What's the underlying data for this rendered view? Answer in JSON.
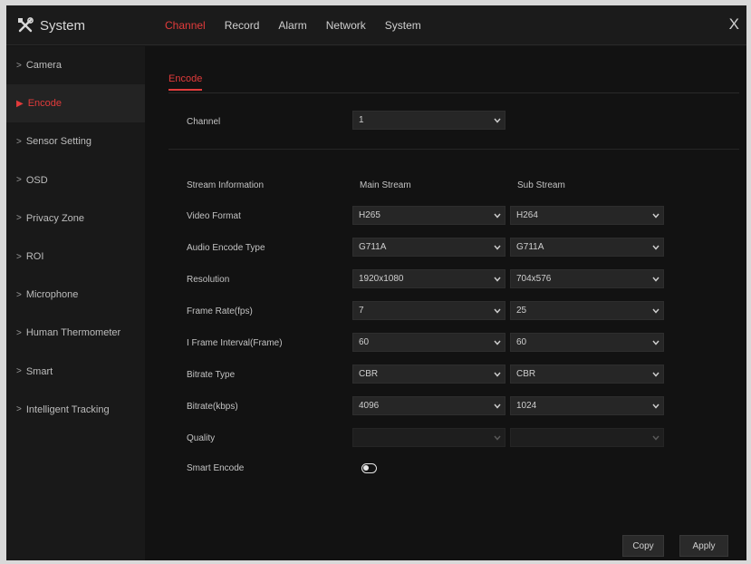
{
  "app": {
    "title": "System",
    "icon": "tools-icon",
    "close_label": "X"
  },
  "tabs": [
    {
      "label": "Channel",
      "active": true
    },
    {
      "label": "Record",
      "active": false
    },
    {
      "label": "Alarm",
      "active": false
    },
    {
      "label": "Network",
      "active": false
    },
    {
      "label": "System",
      "active": false
    }
  ],
  "sidebar": {
    "items": [
      {
        "label": "Camera",
        "active": false
      },
      {
        "label": "Encode",
        "active": true
      },
      {
        "label": "Sensor Setting",
        "active": false
      },
      {
        "label": "OSD",
        "active": false
      },
      {
        "label": "Privacy Zone",
        "active": false
      },
      {
        "label": "ROI",
        "active": false
      },
      {
        "label": "Microphone",
        "active": false
      },
      {
        "label": "Human Thermometer",
        "active": false
      },
      {
        "label": "Smart",
        "active": false
      },
      {
        "label": "Intelligent Tracking",
        "active": false
      }
    ]
  },
  "main": {
    "subtab": "Encode",
    "channel": {
      "label": "Channel",
      "value": "1"
    },
    "columns": {
      "label": "Stream Information",
      "main": "Main Stream",
      "sub": "Sub Stream"
    },
    "rows": [
      {
        "label": "Video Format",
        "main": "H265",
        "sub": "H264",
        "disabled": false
      },
      {
        "label": "Audio Encode Type",
        "main": "G711A",
        "sub": "G711A",
        "disabled": false
      },
      {
        "label": "Resolution",
        "main": "1920x1080",
        "sub": "704x576",
        "disabled": false
      },
      {
        "label": "Frame Rate(fps)",
        "main": "7",
        "sub": "25",
        "disabled": false
      },
      {
        "label": "I Frame Interval(Frame)",
        "main": "60",
        "sub": "60",
        "disabled": false
      },
      {
        "label": "Bitrate Type",
        "main": "CBR",
        "sub": "CBR",
        "disabled": false
      },
      {
        "label": "Bitrate(kbps)",
        "main": "4096",
        "sub": "1024",
        "disabled": false
      },
      {
        "label": "Quality",
        "main": "",
        "sub": "",
        "disabled": true
      }
    ],
    "smart_encode": {
      "label": "Smart Encode",
      "enabled": false
    },
    "buttons": {
      "copy": "Copy",
      "apply": "Apply"
    }
  },
  "colors": {
    "accent": "#e23b3b",
    "background": "#141414",
    "sidebar": "#191919"
  }
}
